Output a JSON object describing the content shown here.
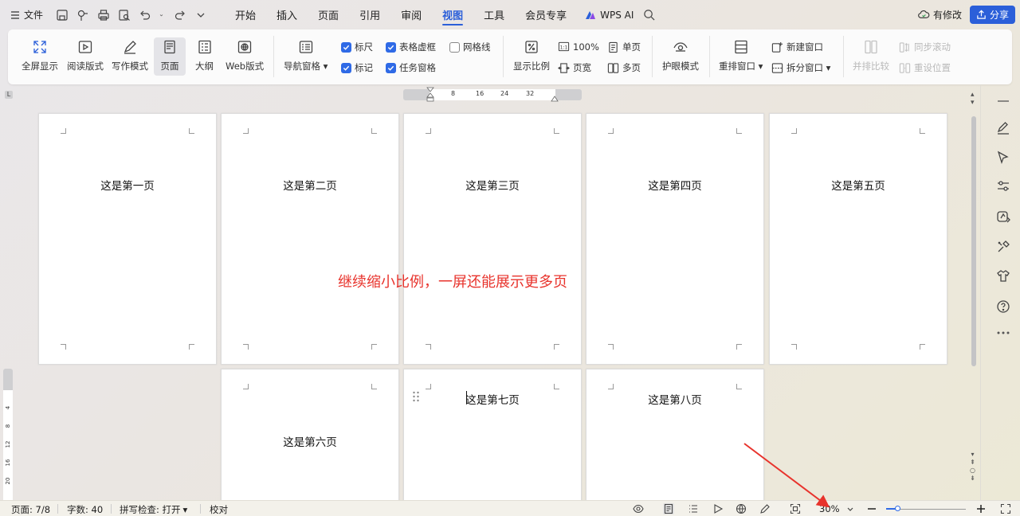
{
  "menubar": {
    "file_label": "文件",
    "tabs": [
      "开始",
      "插入",
      "页面",
      "引用",
      "审阅",
      "视图",
      "工具",
      "会员专享"
    ],
    "active_tab": "视图",
    "wps_ai_label": "WPS AI",
    "modify_label": "有修改",
    "share_label": "分享"
  },
  "ribbon": {
    "fullscreen": "全屏显示",
    "read_mode": "阅读版式",
    "write_mode": "写作模式",
    "page": "页面",
    "outline": "大纲",
    "web": "Web版式",
    "nav_pane": "导航窗格",
    "ruler": "标尺",
    "table_dashed": "表格虚框",
    "gridlines": "网格线",
    "marks": "标记",
    "task_pane": "任务窗格",
    "zoom_ratio": "显示比例",
    "zoom_100": "100%",
    "page_width": "页宽",
    "single_page": "单页",
    "multi_page": "多页",
    "eye_care": "护眼模式",
    "rearrange": "重排窗口",
    "new_window": "新建窗口",
    "split_window": "拆分窗口",
    "side_by_side": "并排比较",
    "sync_scroll": "同步滚动",
    "reset_position": "重设位置",
    "checks": {
      "ruler": true,
      "table_dashed": true,
      "gridlines": false,
      "marks": true,
      "task_pane": true
    }
  },
  "ruler": {
    "ticks": [
      "8",
      "16",
      "24",
      "32"
    ],
    "vticks": [
      "4",
      "8",
      "12",
      "16",
      "20"
    ]
  },
  "pages": [
    "这是第一页",
    "这是第二页",
    "这是第三页",
    "这是第四页",
    "这是第五页",
    "这是第六页",
    "这是第七页",
    "这是第八页"
  ],
  "overlay_text": "继续缩小比例，一屏还能展示更多页",
  "status": {
    "page_label": "页面: 7/8",
    "word_count": "字数: 40",
    "spell_check": "拼写检查: 打开",
    "proofread": "校对",
    "zoom": "30%",
    "zoom_value": 0.3
  },
  "colors": {
    "accent": "#2b5fd9",
    "annotation": "#e8332c"
  }
}
